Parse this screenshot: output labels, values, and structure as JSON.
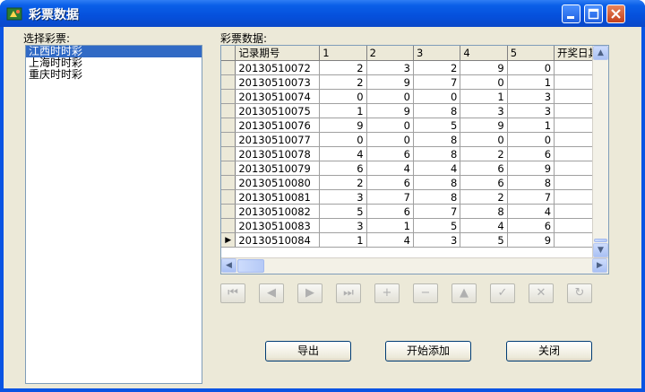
{
  "window": {
    "title": "彩票数据"
  },
  "lottery_list": {
    "label": "选择彩票:",
    "items": [
      "江西时时彩",
      "上海时时彩",
      "重庆时时彩"
    ],
    "selected_index": 0
  },
  "data_grid": {
    "label": "彩票数据:",
    "columns": [
      "记录期号",
      "1",
      "2",
      "3",
      "4",
      "5",
      "开奖日其"
    ],
    "rows": [
      [
        "20130510072",
        "2",
        "3",
        "2",
        "9",
        "0",
        ""
      ],
      [
        "20130510073",
        "2",
        "9",
        "7",
        "0",
        "1",
        ""
      ],
      [
        "20130510074",
        "0",
        "0",
        "0",
        "1",
        "3",
        ""
      ],
      [
        "20130510075",
        "1",
        "9",
        "8",
        "3",
        "3",
        ""
      ],
      [
        "20130510076",
        "9",
        "0",
        "5",
        "9",
        "1",
        ""
      ],
      [
        "20130510077",
        "0",
        "0",
        "8",
        "0",
        "0",
        ""
      ],
      [
        "20130510078",
        "4",
        "6",
        "8",
        "2",
        "6",
        ""
      ],
      [
        "20130510079",
        "6",
        "4",
        "4",
        "6",
        "9",
        ""
      ],
      [
        "20130510080",
        "2",
        "6",
        "8",
        "6",
        "8",
        ""
      ],
      [
        "20130510081",
        "3",
        "7",
        "8",
        "2",
        "7",
        ""
      ],
      [
        "20130510082",
        "5",
        "6",
        "7",
        "8",
        "4",
        ""
      ],
      [
        "20130510083",
        "3",
        "1",
        "5",
        "4",
        "6",
        ""
      ],
      [
        "20130510084",
        "1",
        "4",
        "3",
        "5",
        "9",
        ""
      ]
    ],
    "current_row_index": 12
  },
  "navigator": {
    "buttons": [
      {
        "name": "first",
        "glyph": "⏮"
      },
      {
        "name": "prior",
        "glyph": "◀"
      },
      {
        "name": "next",
        "glyph": "▶"
      },
      {
        "name": "last",
        "glyph": "⏭"
      },
      {
        "name": "insert",
        "glyph": "+"
      },
      {
        "name": "delete",
        "glyph": "−"
      },
      {
        "name": "edit",
        "glyph": "▲"
      },
      {
        "name": "post",
        "glyph": "✓"
      },
      {
        "name": "cancel",
        "glyph": "✕"
      },
      {
        "name": "refresh",
        "glyph": "↻"
      }
    ]
  },
  "buttons": {
    "export": "导出",
    "start_add": "开始添加",
    "close": "关闭"
  },
  "icons": {
    "app": "app-icon",
    "minimize": "minimize-icon",
    "maximize": "maximize-icon",
    "close": "close-icon"
  },
  "colors": {
    "titlebar": "#0550dc",
    "selection": "#316ac5",
    "face": "#ece9d8"
  }
}
